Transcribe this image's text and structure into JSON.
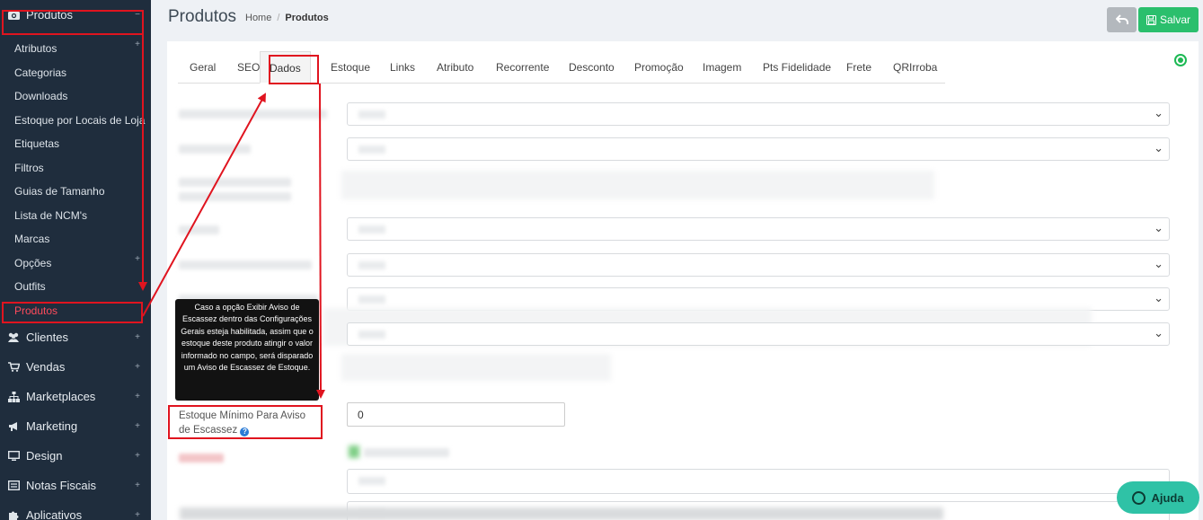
{
  "sidebar": {
    "catalog_section": "Produtos",
    "catalog_items": [
      {
        "label": "Atributos",
        "has_plus": true
      },
      {
        "label": "Categorias",
        "has_plus": false
      },
      {
        "label": "Downloads",
        "has_plus": false
      },
      {
        "label": "Estoque por Locais de Loja",
        "has_plus": false
      },
      {
        "label": "Etiquetas",
        "has_plus": false
      },
      {
        "label": "Filtros",
        "has_plus": false
      },
      {
        "label": "Guias de Tamanho",
        "has_plus": false
      },
      {
        "label": "Lista de NCM's",
        "has_plus": false
      },
      {
        "label": "Marcas",
        "has_plus": false
      },
      {
        "label": "Opções",
        "has_plus": true
      },
      {
        "label": "Outfits",
        "has_plus": false
      },
      {
        "label": "Produtos",
        "has_plus": false
      }
    ],
    "sections": [
      {
        "label": "Clientes",
        "icon": "users-icon"
      },
      {
        "label": "Vendas",
        "icon": "cart-icon"
      },
      {
        "label": "Marketplaces",
        "icon": "sitemap-icon"
      },
      {
        "label": "Marketing",
        "icon": "megaphone-icon"
      },
      {
        "label": "Design",
        "icon": "monitor-icon"
      },
      {
        "label": "Notas Fiscais",
        "icon": "invoice-icon"
      },
      {
        "label": "Aplicativos",
        "icon": "puzzle-icon"
      }
    ]
  },
  "header": {
    "title": "Produtos",
    "breadcrumb_home": "Home",
    "breadcrumb_sep": "/",
    "breadcrumb_current": "Produtos",
    "save_label": "Salvar"
  },
  "tabs": [
    "Geral",
    "SEO",
    "Dados",
    "Estoque",
    "Links",
    "Atributo",
    "Recorrente",
    "Desconto",
    "Promoção",
    "Imagem",
    "Pts Fidelidade",
    "Frete",
    "QRIrroba"
  ],
  "active_tab": "Dados",
  "tooltip": "Caso a opção Exibir Aviso de Escassez dentro das Configurações Gerais esteja habilitada, assim que o estoque deste produto atingir o valor informado no campo, será disparado um Aviso de Escassez de Estoque.",
  "field": {
    "label": "Estoque Mínimo Para Aviso de Escassez",
    "help": "?",
    "value": "0"
  },
  "help_button": "Ajuda",
  "colors": {
    "sidebar_bg": "#1f2d3d",
    "save_green": "#2bbf6d",
    "annotation_red": "#e0141f",
    "help_teal": "#2fc2a6"
  }
}
